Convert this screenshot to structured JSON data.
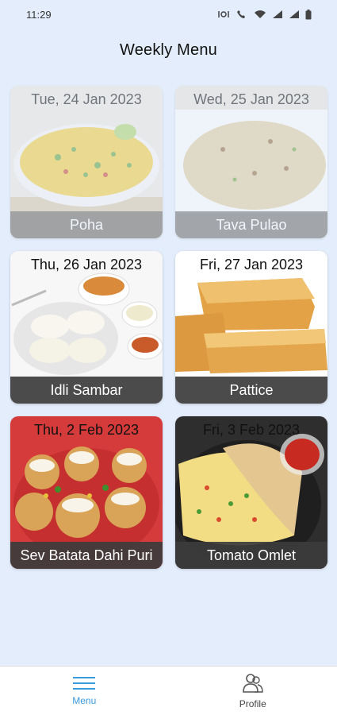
{
  "status_bar": {
    "time": "11:29"
  },
  "header": {
    "title": "Weekly Menu"
  },
  "menu": [
    {
      "date": "Tue, 24 Jan 2023",
      "dish": "Poha",
      "faded": true,
      "image": "poha-photo"
    },
    {
      "date": "Wed, 25 Jan 2023",
      "dish": "Tava Pulao",
      "faded": true,
      "image": "pulao-photo"
    },
    {
      "date": "Thu, 26 Jan 2023",
      "dish": "Idli Sambar",
      "faded": false,
      "image": "idli-photo"
    },
    {
      "date": "Fri, 27 Jan 2023",
      "dish": "Pattice",
      "faded": false,
      "image": "pattice-photo"
    },
    {
      "date": "Thu, 2 Feb 2023",
      "dish": "Sev Batata Dahi Puri",
      "faded": false,
      "image": "dahi-puri-photo"
    },
    {
      "date": "Fri, 3 Feb 2023",
      "dish": "Tomato Omlet",
      "faded": false,
      "image": "omelet-photo"
    }
  ],
  "bottom_nav": {
    "items": [
      {
        "label": "Menu",
        "icon": "menu-icon",
        "active": true
      },
      {
        "label": "Profile",
        "icon": "profile-icon",
        "active": false
      }
    ]
  },
  "colors": {
    "accent": "#3a9bdc",
    "background": "#e3edfb"
  }
}
